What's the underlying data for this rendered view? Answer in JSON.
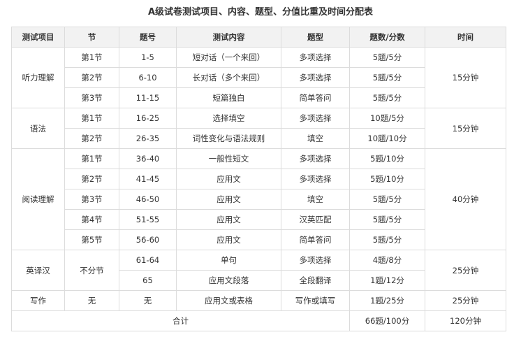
{
  "title": "A级试卷测试项目、内容、题型、分值比重及时间分配表",
  "headers": [
    "测试项目",
    "节",
    "题号",
    "测试内容",
    "题型",
    "题数/分数",
    "时间"
  ],
  "groups": [
    {
      "item": "听力理解",
      "time": "15分钟",
      "rows": [
        {
          "section": "第1节",
          "number": "1-5",
          "content": "短对话（一个来回）",
          "type": "多项选择",
          "score": "5题/5分"
        },
        {
          "section": "第2节",
          "number": "6-10",
          "content": "长对话（多个来回）",
          "type": "多项选择",
          "score": "5题/5分"
        },
        {
          "section": "第3节",
          "number": "11-15",
          "content": "短篇独白",
          "type": "简单答问",
          "score": "5题/5分"
        }
      ]
    },
    {
      "item": "语法",
      "time": "15分钟",
      "rows": [
        {
          "section": "第1节",
          "number": "16-25",
          "content": "选择填空",
          "type": "多项选择",
          "score": "10题/5分"
        },
        {
          "section": "第2节",
          "number": "26-35",
          "content": "词性变化与语法规则",
          "type": "填空",
          "score": "10题/10分"
        }
      ]
    },
    {
      "item": "阅读理解",
      "time": "40分钟",
      "rows": [
        {
          "section": "第1节",
          "number": "36-40",
          "content": "一般性短文",
          "type": "多项选择",
          "score": "5题/10分"
        },
        {
          "section": "第2节",
          "number": "41-45",
          "content": "应用文",
          "type": "多项选择",
          "score": "5题/10分"
        },
        {
          "section": "第3节",
          "number": "46-50",
          "content": "应用文",
          "type": "填空",
          "score": "5题/5分"
        },
        {
          "section": "第4节",
          "number": "51-55",
          "content": "应用文",
          "type": "汉英匹配",
          "score": "5题/5分"
        },
        {
          "section": "第5节",
          "number": "56-60",
          "content": "应用文",
          "type": "简单答问",
          "score": "5题/5分"
        }
      ]
    },
    {
      "item": "英译汉",
      "time": "25分钟",
      "section_shared": "不分节",
      "rows": [
        {
          "number": "61-64",
          "content": "单句",
          "type": "多项选择",
          "score": "4题/8分"
        },
        {
          "number": "65",
          "content": "应用文段落",
          "type": "全段翻译",
          "score": "1题/12分"
        }
      ]
    },
    {
      "item": "写作",
      "time": "25分钟",
      "rows": [
        {
          "section": "无",
          "number": "无",
          "content": "应用文或表格",
          "type": "写作或填写",
          "score": "1题/25分"
        }
      ]
    }
  ],
  "total": {
    "label": "合计",
    "score": "66题/100分",
    "time": "120分钟"
  }
}
